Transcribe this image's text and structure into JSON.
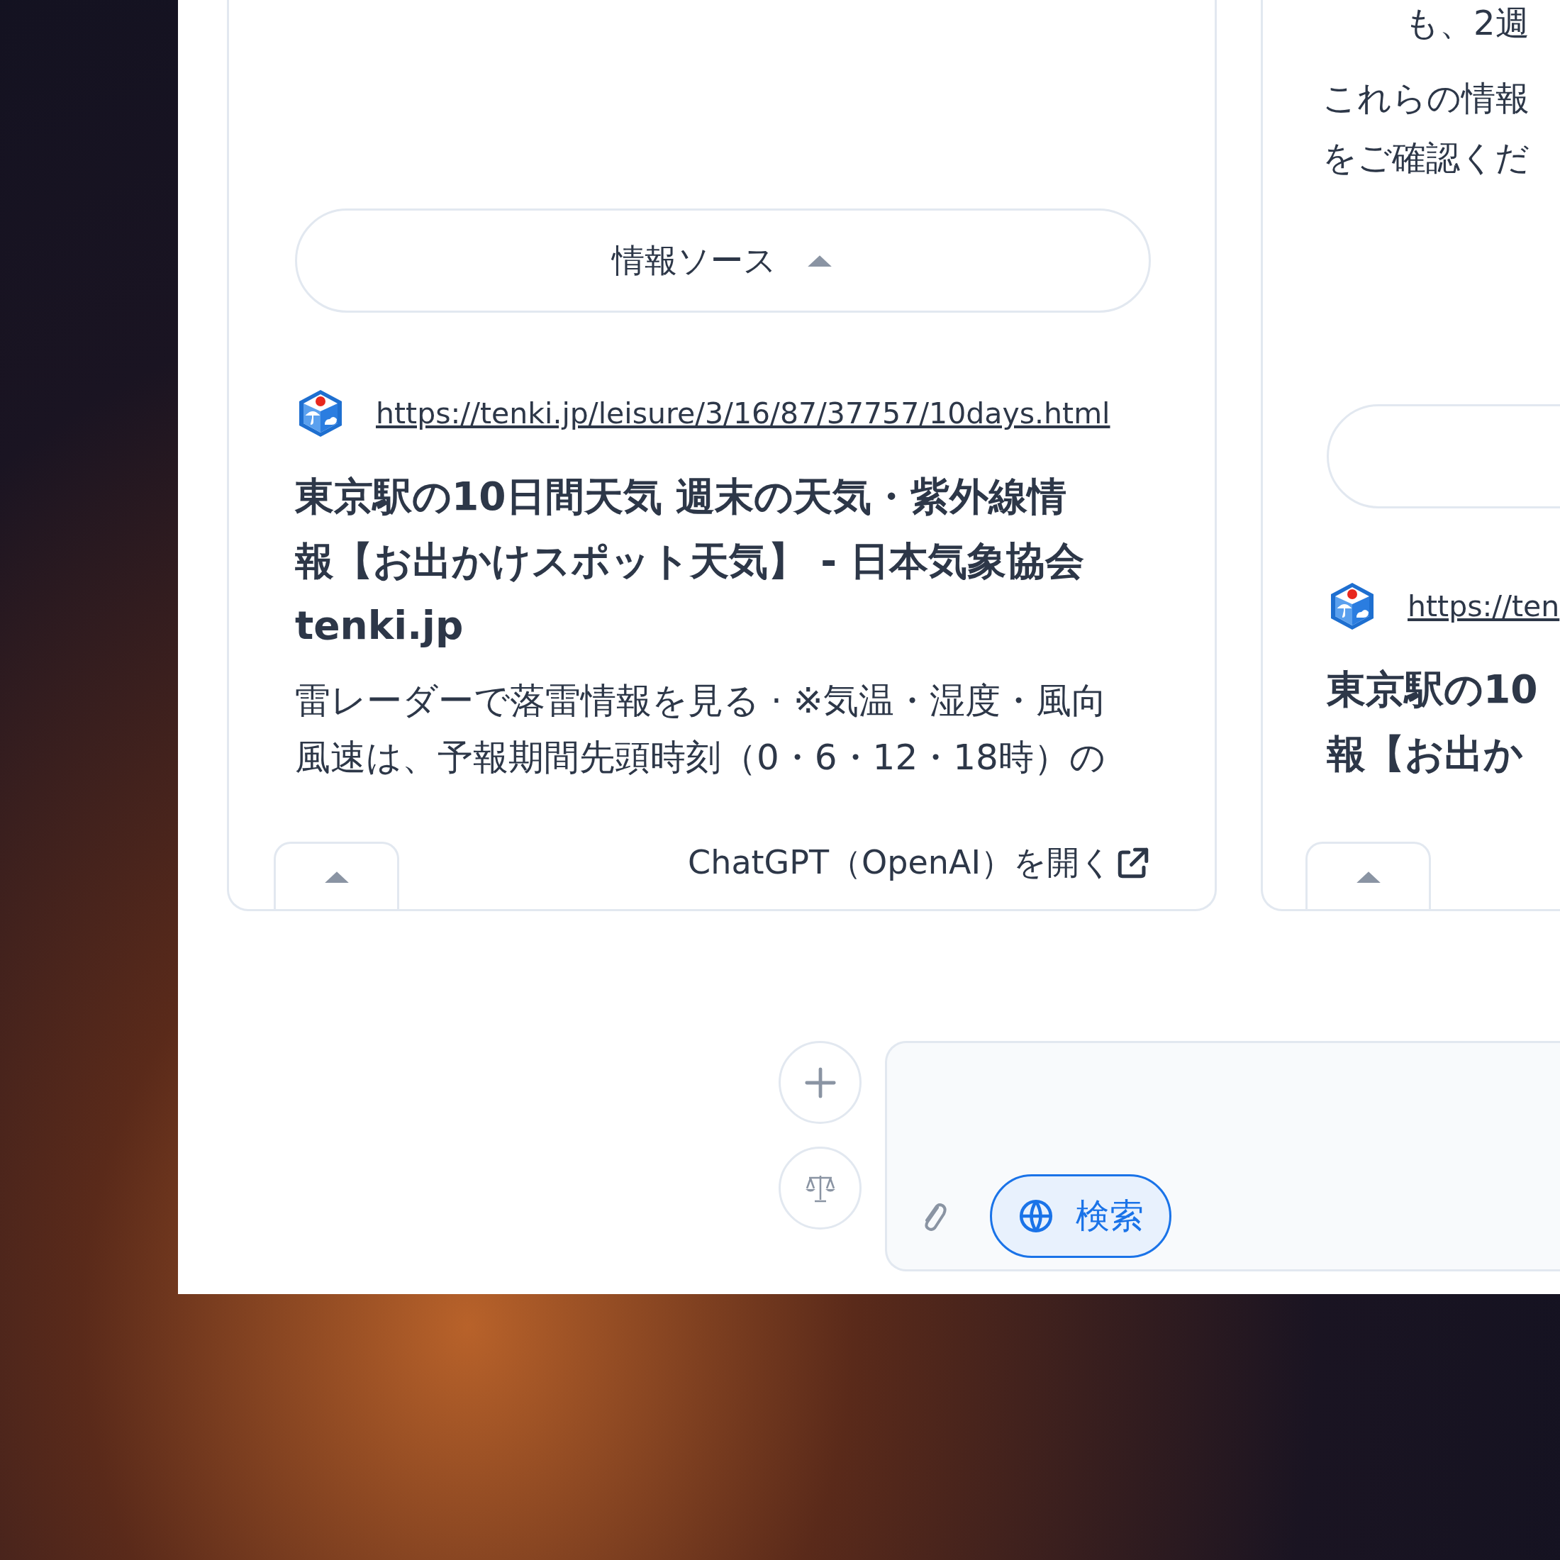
{
  "cards": [
    {
      "sources_button": {
        "label": "情報ソース",
        "expanded": true
      },
      "source": {
        "url": "https://tenki.jp/leisure/3/16/87/37757/10days.html",
        "title_lines": [
          "東京駅の10日間天気 週末の天気・紫外線情",
          "報【お出かけスポット天気】 - 日本気象協会",
          "tenki.jp"
        ],
        "snippet_lines": [
          "雷レーダーで落雷情報を見る · ※気温・湿度・風向",
          "風速は、予報期間先頭時刻（0・6・12・18時）の"
        ]
      },
      "open_link": "ChatGPT（OpenAI）を開く"
    },
    {
      "body_lines": [
        [
          "も、2週"
        ],
        [
          "これらの情報",
          "をご確認くだ"
        ]
      ],
      "source": {
        "url": "https://ten",
        "title_lines": [
          "東京駅の10",
          "報【お出か"
        ]
      }
    }
  ],
  "composer": {
    "search_button": {
      "label": "検索",
      "selected": true
    }
  }
}
